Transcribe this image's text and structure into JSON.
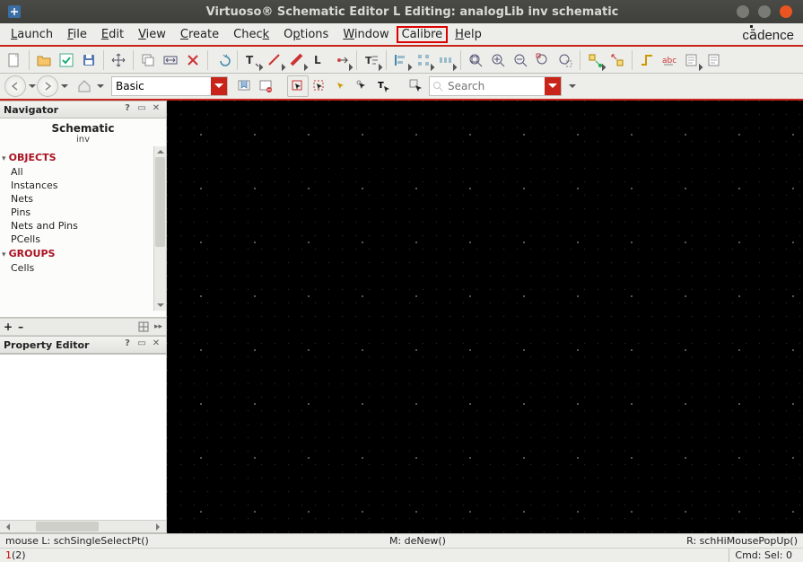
{
  "window": {
    "title": "Virtuoso® Schematic Editor L Editing: analogLib inv schematic"
  },
  "brand": "cādence",
  "menus": {
    "launch": "Launch",
    "file": "File",
    "edit": "Edit",
    "view": "View",
    "create": "Create",
    "check": "Check",
    "options": "Options",
    "window": "Window",
    "calibre": "Calibre",
    "help": "Help"
  },
  "highlighted_menu": "calibre",
  "toolbar2": {
    "view_selector": "Basic",
    "search_placeholder": "Search"
  },
  "navigator": {
    "panel_title": "Navigator",
    "header_title": "Schematic",
    "header_sub": "inv",
    "groups": [
      {
        "label": "OBJECTS",
        "items": [
          "All",
          "Instances",
          "Nets",
          "Pins",
          "Nets and Pins",
          "PCells"
        ]
      },
      {
        "label": "GROUPS",
        "items": [
          "Cells"
        ]
      }
    ]
  },
  "property_editor": {
    "panel_title": "Property Editor"
  },
  "status": {
    "mouse_left": "mouse L: schSingleSelectPt()",
    "mouse_mid": "M: deNew()",
    "mouse_right": "R: schHiMousePopUp()",
    "line2_left_a": "1",
    "line2_left_b": "(2)",
    "cmd": "Cmd: Sel: 0"
  },
  "colors": {
    "accent_red": "#c8241a"
  }
}
